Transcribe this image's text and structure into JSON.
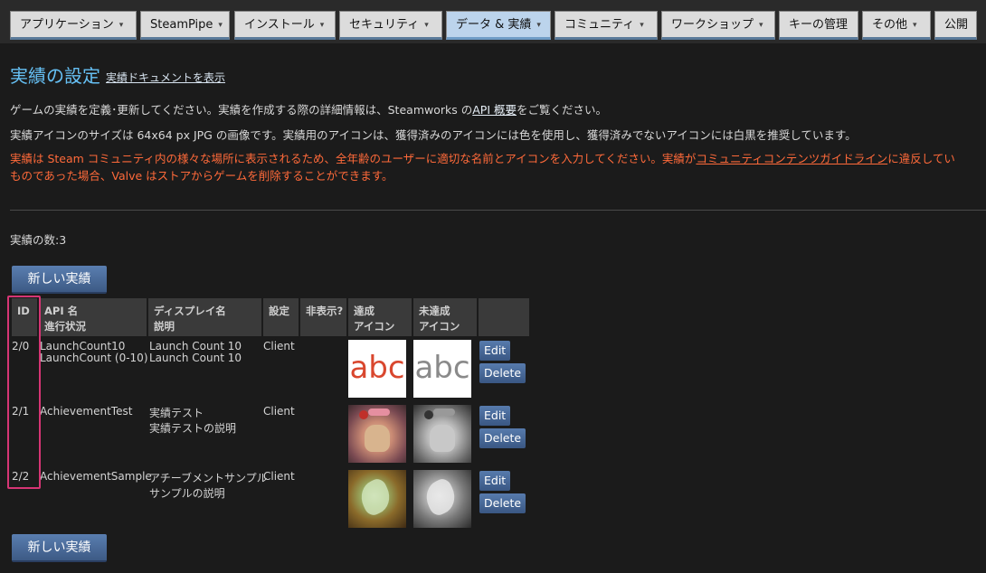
{
  "nav": {
    "tabs": [
      {
        "label": "アプリケーション",
        "caret": "▾"
      },
      {
        "label": "SteamPipe",
        "caret": "▾"
      },
      {
        "label": "インストール",
        "caret": "▾"
      },
      {
        "label": "セキュリティ",
        "caret": "▾"
      },
      {
        "label": "データ & 実績",
        "caret": "▾"
      },
      {
        "label": "コミュニティ",
        "caret": "▾"
      },
      {
        "label": "ワークショップ",
        "caret": "▾"
      },
      {
        "label": "キーの管理",
        "caret": ""
      },
      {
        "label": "その他",
        "caret": "▾"
      },
      {
        "label": "公開",
        "caret": ""
      }
    ],
    "active_index": 4
  },
  "header": {
    "title": "実績の設定",
    "doc_link": "実績ドキュメントを表示"
  },
  "intro": {
    "line1_before": "ゲームの実績を定義･更新してください。実績を作成する際の詳細情報は、Steamworks の",
    "line1_link": "API 概要",
    "line1_after": "をご覧ください。",
    "line2": "実績アイコンのサイズは 64x64 px JPG の画像です。実績用のアイコンは、獲得済みのアイコンには色を使用し、獲得済みでないアイコンには白黒を推奨しています。",
    "warn_before": "実績は Steam コミュニティ内の様々な場所に表示されるため、全年齢のユーザーに適切な名前とアイコンを入力してください。実績が",
    "warn_link": "コミュニティコンテンツガイドライン",
    "warn_after": "に違反してい",
    "warn_line2": "ものであった場合、Valve はストアからゲームを削除することができます。"
  },
  "count_text": "実績の数:3",
  "new_button": "新しい実績",
  "table": {
    "headers": {
      "id": "ID",
      "api_1": "API 名",
      "api_2": "進行状況",
      "disp_1": "ディスプレイ名",
      "disp_2": "説明",
      "setting": "設定",
      "hidden": "非表示?",
      "ach_1": "達成",
      "ach_2": "アイコン",
      "unach_1": "未達成",
      "unach_2": "アイコン"
    },
    "rows": [
      {
        "id": "2/0",
        "api": "LaunchCount10",
        "progress": "LaunchCount (0-10)",
        "name": "Launch Count 10",
        "desc": "Launch Count 10",
        "setting": "Client",
        "icon_text": "abc"
      },
      {
        "id": "2/1",
        "api": "AchievementTest",
        "progress": "",
        "name": "実績テスト",
        "desc": "実績テストの説明",
        "setting": "Client",
        "icon_text": ""
      },
      {
        "id": "2/2",
        "api": "AchievementSample",
        "progress": "",
        "name": "アチーブメントサンプル",
        "desc": "サンプルの説明",
        "setting": "Client",
        "icon_text": ""
      }
    ],
    "edit_label": "Edit",
    "delete_label": "Delete"
  },
  "colors": {
    "accent": "#66c0f4",
    "warning": "#ff6a3a",
    "highlight": "#d63574",
    "button": "#4a6b9c"
  }
}
